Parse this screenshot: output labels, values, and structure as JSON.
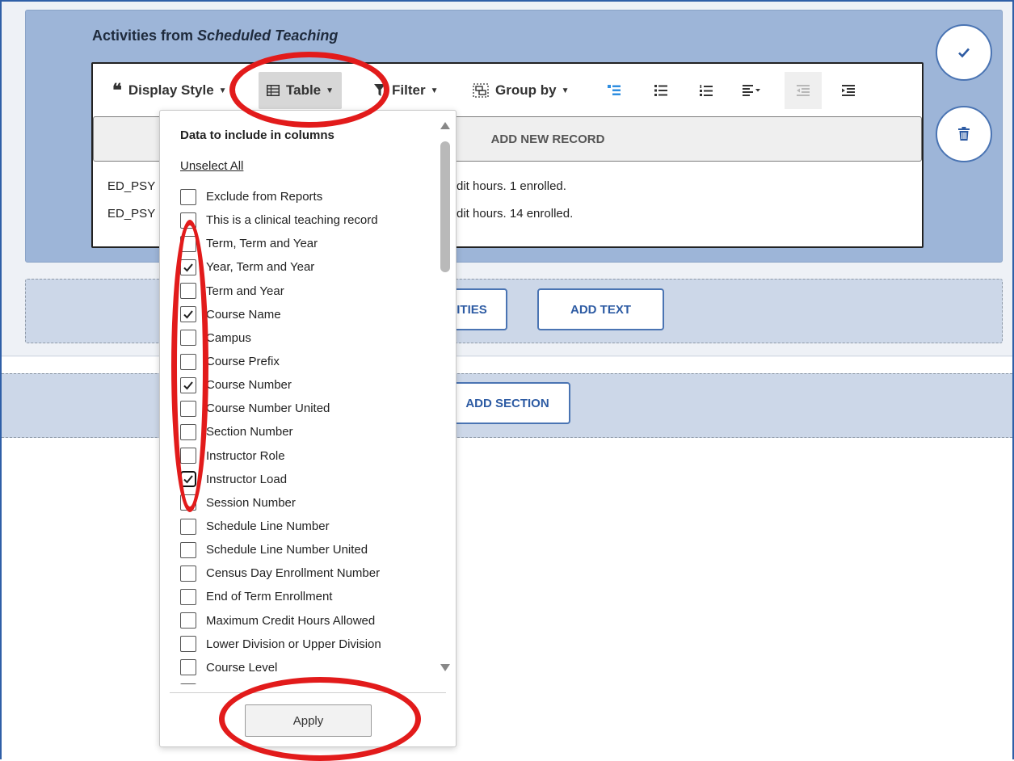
{
  "section": {
    "title_prefix": "Activities from ",
    "title_emphasis": "Scheduled Teaching"
  },
  "toolbar": {
    "display_style": "Display Style",
    "table": "Table",
    "filter": "Filter",
    "group_by": "Group by"
  },
  "records": {
    "add_new_record": "ADD NEW RECORD",
    "rows": [
      {
        "left": "ED_PSY",
        "right": "dit hours. 1 enrolled."
      },
      {
        "left": "ED_PSY",
        "right": "dit hours. 14 enrolled."
      }
    ]
  },
  "zone_buttons": {
    "activities_partial": "ITIES",
    "add_text": "ADD TEXT",
    "add_section": "ADD SECTION"
  },
  "dropdown": {
    "heading": "Data to include in columns",
    "unselect_all": "Unselect All",
    "apply": "Apply",
    "items": [
      {
        "label": "Exclude from Reports",
        "checked": false
      },
      {
        "label": "This is a clinical teaching record",
        "checked": false
      },
      {
        "label": "Term, Term and Year",
        "checked": false
      },
      {
        "label": "Year, Term and Year",
        "checked": true
      },
      {
        "label": "Term and Year",
        "checked": false
      },
      {
        "label": "Course Name",
        "checked": true
      },
      {
        "label": "Campus",
        "checked": false
      },
      {
        "label": "Course Prefix",
        "checked": false
      },
      {
        "label": "Course Number",
        "checked": true
      },
      {
        "label": "Course Number United",
        "checked": false
      },
      {
        "label": "Section Number",
        "checked": false
      },
      {
        "label": "Instructor Role",
        "checked": false
      },
      {
        "label": "Instructor Load",
        "checked": true,
        "focused": true
      },
      {
        "label": "Session Number",
        "checked": false
      },
      {
        "label": "Schedule Line Number",
        "checked": false
      },
      {
        "label": "Schedule Line Number United",
        "checked": false
      },
      {
        "label": "Census Day Enrollment Number",
        "checked": false
      },
      {
        "label": "End of Term Enrollment",
        "checked": false
      },
      {
        "label": "Maximum Credit Hours Allowed",
        "checked": false
      },
      {
        "label": "Lower Division or Upper Division",
        "checked": false
      },
      {
        "label": "Course Level",
        "checked": false
      },
      {
        "label": "",
        "checked": false
      }
    ]
  },
  "colors": {
    "accent": "#2d5ba3",
    "annotation": "#e21b1b",
    "section_bg": "#9db5d8"
  }
}
